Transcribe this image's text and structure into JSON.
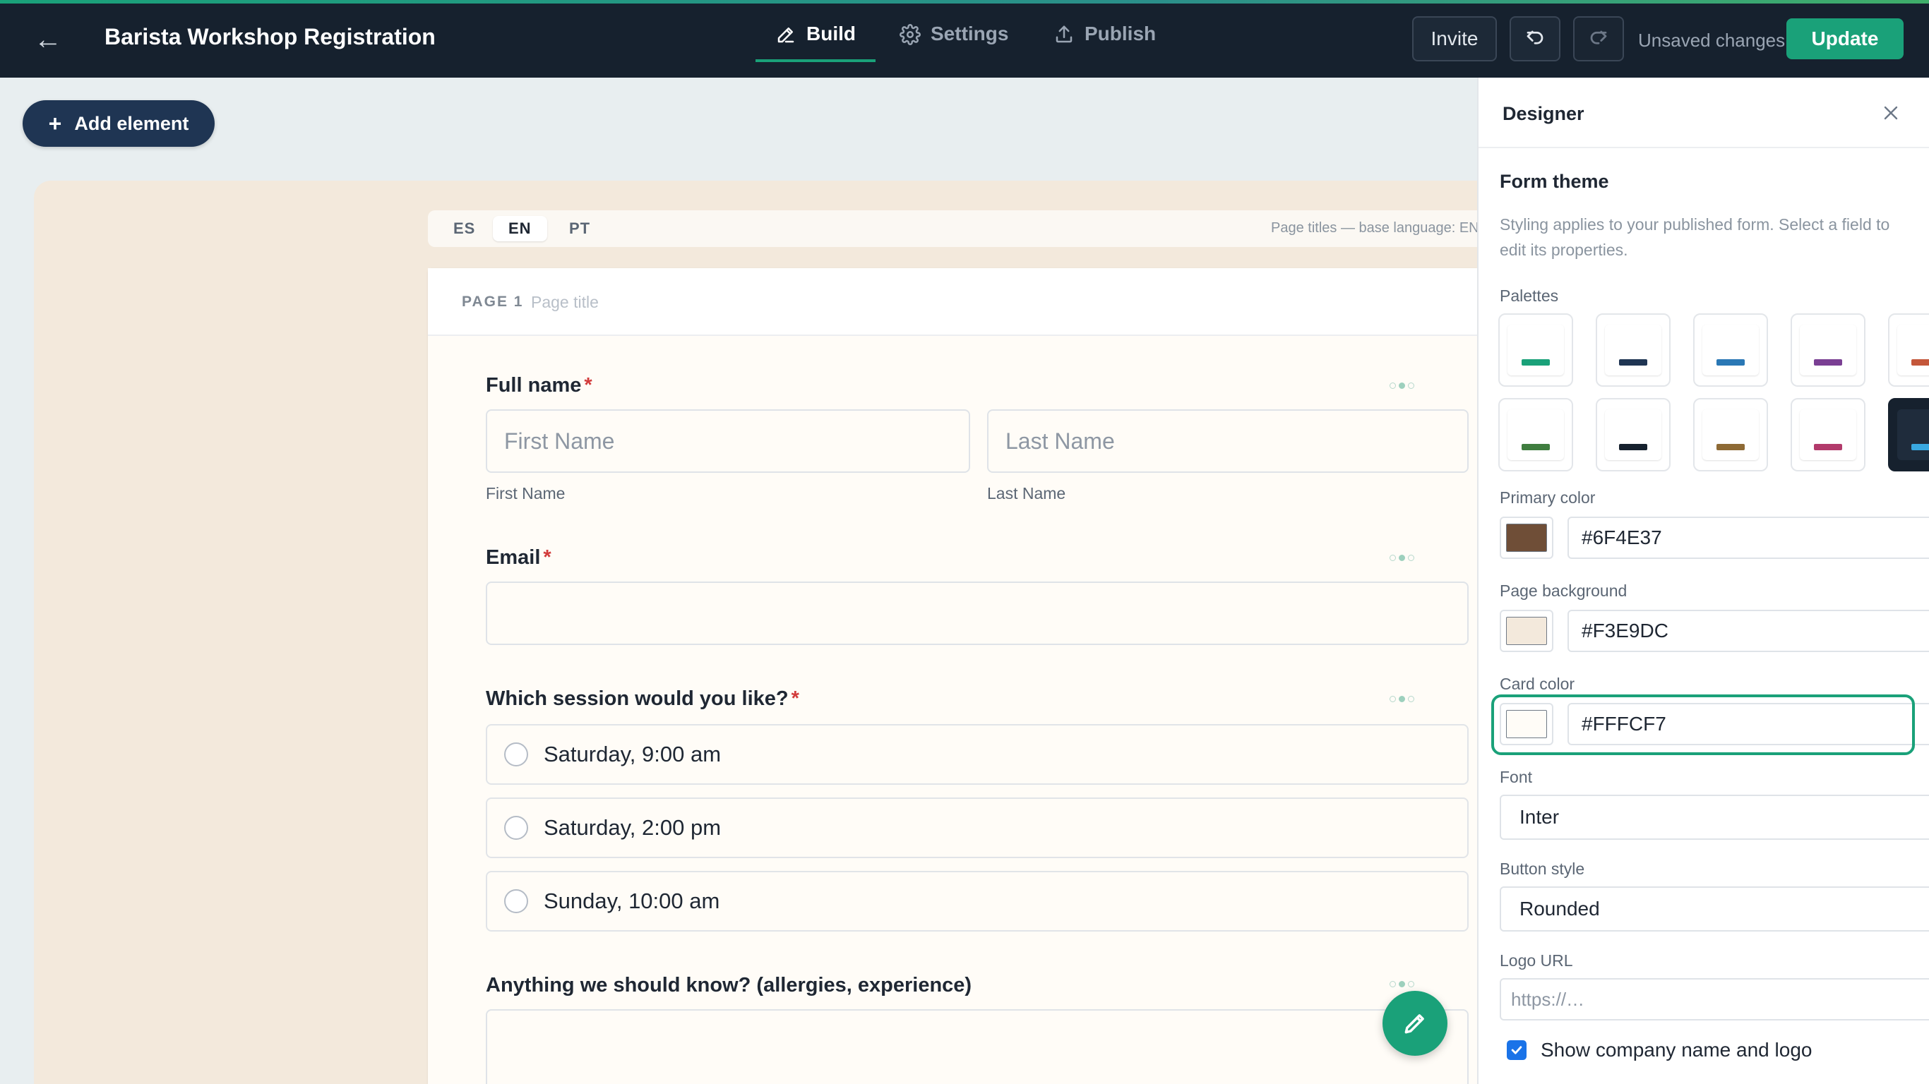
{
  "app": {
    "title": "Barista Workshop Registration"
  },
  "nav": {
    "tabs": [
      {
        "label": "Build",
        "icon": "pencil-icon",
        "active": true
      },
      {
        "label": "Settings",
        "icon": "gear-icon",
        "active": false
      },
      {
        "label": "Publish",
        "icon": "upload-icon",
        "active": false
      }
    ]
  },
  "toolbar": {
    "invite_label": "Invite",
    "unsaved_label": "Unsaved changes",
    "update_label": "Update"
  },
  "canvas": {
    "add_element_label": "Add element",
    "languages": [
      "ES",
      "EN",
      "PT"
    ],
    "active_language": "EN",
    "language_hint": "Page titles — base language: EN",
    "page_label": "PAGE 1",
    "page_title_placeholder": "Page title"
  },
  "form": {
    "full_name": {
      "label": "Full name",
      "required_mark": "*",
      "first_placeholder": "First Name",
      "last_placeholder": "Last Name",
      "first_sub": "First Name",
      "last_sub": "Last Name"
    },
    "email": {
      "label": "Email",
      "required_mark": "*",
      "value": ""
    },
    "session": {
      "label": "Which session would you like?",
      "required_mark": "*",
      "options": [
        "Saturday, 9:00 am",
        "Saturday, 2:00 pm",
        "Sunday, 10:00 am"
      ]
    },
    "notes": {
      "label": "Anything we should know? (allergies, experience)"
    }
  },
  "designer": {
    "title": "Designer",
    "section_title": "Form theme",
    "section_desc": "Styling applies to your published form. Select a field to edit its properties.",
    "palettes_label": "Palettes",
    "palettes": [
      {
        "accent": "#1aa179",
        "selected": false
      },
      {
        "accent": "#1f3553",
        "selected": false
      },
      {
        "accent": "#2a78b5",
        "selected": false
      },
      {
        "accent": "#7a3f93",
        "selected": false
      },
      {
        "accent": "#c4573a",
        "selected": false
      },
      {
        "accent": "#3f7d3f",
        "selected": false
      },
      {
        "accent": "#16212e",
        "selected": false
      },
      {
        "accent": "#8e6a35",
        "selected": false
      },
      {
        "accent": "#b23a6b",
        "selected": false
      },
      {
        "accent": "#39a8e0",
        "selected": true
      }
    ],
    "primary_color": {
      "label": "Primary color",
      "value": "#6F4E37",
      "swatch": "#6F4E37"
    },
    "page_background": {
      "label": "Page background",
      "value": "#F3E9DC",
      "swatch": "#F3E9DC"
    },
    "card_color": {
      "label": "Card color",
      "value": "#FFFCF7",
      "swatch": "#FFFCF7"
    },
    "font": {
      "label": "Font",
      "value": "Inter"
    },
    "button_style": {
      "label": "Button style",
      "value": "Rounded"
    },
    "logo_url": {
      "label": "Logo URL",
      "placeholder": "https://…",
      "value": ""
    },
    "show_company": {
      "label": "Show company name and logo",
      "checked": true
    }
  }
}
